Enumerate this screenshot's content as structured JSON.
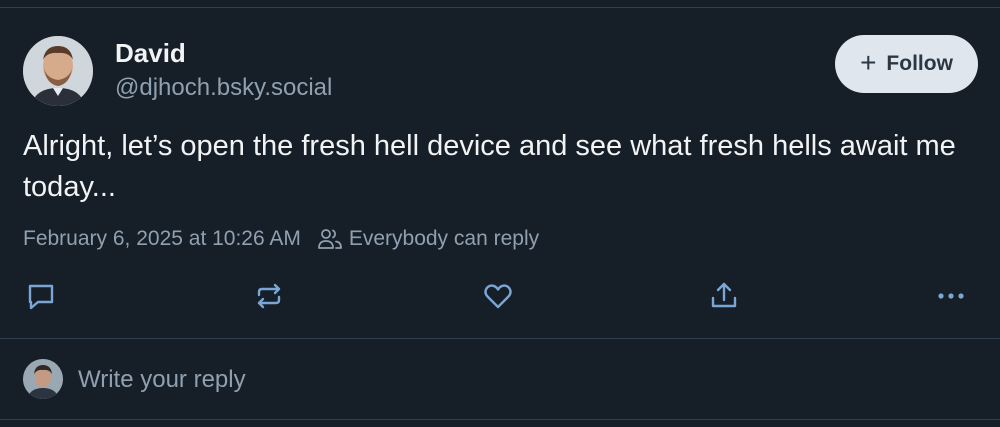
{
  "post": {
    "author": {
      "display_name": "David",
      "handle": "@djhoch.bsky.social"
    },
    "follow_button": {
      "icon": "plus-icon",
      "label": "Follow"
    },
    "text": "Alright, let’s open the fresh hell device and see what fresh hells await me today...",
    "timestamp": "February 6, 2025 at 10:26 AM",
    "reply_setting": "Everybody can reply",
    "actions": [
      {
        "name": "reply",
        "icon": "comment-icon"
      },
      {
        "name": "repost",
        "icon": "repost-icon"
      },
      {
        "name": "like",
        "icon": "heart-icon"
      },
      {
        "name": "share",
        "icon": "share-icon"
      },
      {
        "name": "more",
        "icon": "more-icon"
      }
    ]
  },
  "reply_composer": {
    "placeholder": "Write your reply"
  },
  "colors": {
    "background": "#161e27",
    "text_primary": "#f1f3f5",
    "text_secondary": "#8fa0b0",
    "divider": "#2e4052",
    "icon": "#7aa6d6",
    "follow_button_bg": "#dfe6ee"
  }
}
